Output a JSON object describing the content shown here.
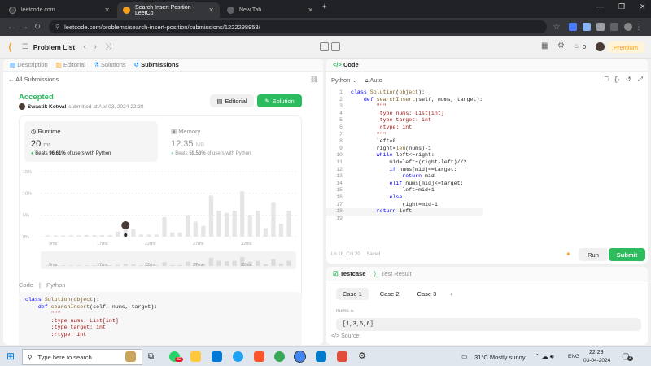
{
  "browser": {
    "tabs": [
      {
        "title": "leetcode.com",
        "active": false
      },
      {
        "title": "Search Insert Position - LeetCo",
        "active": true
      },
      {
        "title": "New Tab",
        "active": false
      }
    ],
    "url": "leetcode.com/problems/search-insert-position/submissions/1222298958/"
  },
  "header": {
    "logo": "⟨",
    "problem_list": "Problem List",
    "coins": "0",
    "premium": "Premium"
  },
  "left_tabs": [
    "Description",
    "Editorial",
    "Solutions",
    "Submissions"
  ],
  "all_submissions": "All Submissions",
  "result": {
    "status": "Accepted",
    "user": "Swastik Kotwal",
    "submitted": "submitted at Apr 03, 2024 22:28",
    "editorial_btn": "Editorial",
    "solution_btn": "Solution"
  },
  "runtime": {
    "label": "Runtime",
    "value": "20",
    "unit": "ms",
    "beats_prefix": "Beats",
    "beats_pct": "96.61%",
    "beats_suffix": "of users with Python"
  },
  "memory": {
    "label": "Memory",
    "value": "12.35",
    "unit": "MB",
    "beats_prefix": "Beats",
    "beats_pct": "59.53%",
    "beats_suffix": "of users with Python"
  },
  "chart_data": {
    "type": "bar",
    "y_ticks": [
      "15%",
      "10%",
      "5%",
      "0%"
    ],
    "x_ticks": [
      "9ms",
      "17ms",
      "22ms",
      "27ms",
      "32ms"
    ],
    "ylim": [
      0,
      15
    ],
    "values": [
      0.3,
      0.3,
      0.3,
      0.3,
      0.3,
      0.4,
      0.4,
      0.4,
      0.4,
      1.2,
      2.5,
      1.8,
      0.5,
      0.5,
      0.5,
      4.5,
      1.0,
      1.0,
      5.0,
      3.5,
      2.5,
      9.5,
      6.0,
      5.5,
      6.0,
      10.5,
      5.0,
      6.0,
      2.0,
      8.0,
      3.0,
      6.0
    ]
  },
  "code_label": "Code",
  "code_lang": "Python",
  "right": {
    "title": "Code",
    "lang": "Python",
    "auto": "Auto",
    "status": "Ln 18, Col 20",
    "saved": "Saved",
    "run": "Run",
    "submit": "Submit",
    "lines": [
      "class Solution(object):",
      "    def searchInsert(self, nums, target):",
      "        \"\"\"",
      "        :type nums: List[int]",
      "        :type target: int",
      "        :rtype: int",
      "        \"\"\"",
      "        left=0",
      "        right=len(nums)-1",
      "        while left<=right:",
      "            mid=left+(right-left)//2",
      "            if nums[mid]==target:",
      "                return mid",
      "            elif nums[mid]<=target:",
      "                left=mid+1",
      "            else:",
      "                right=mid-1",
      "        return left",
      ""
    ]
  },
  "left_code": [
    "class Solution(object):",
    "    def searchInsert(self, nums, target):",
    "        \"\"\"",
    "        :type nums: List[int]",
    "        :type target: int",
    "        :rtype: int"
  ],
  "testcase": {
    "tab1": "Testcase",
    "tab2": "Test Result",
    "cases": [
      "Case 1",
      "Case 2",
      "Case 3"
    ],
    "add": "+",
    "nums_label": "nums =",
    "nums_value": "[1,3,5,6]",
    "source": "Source"
  },
  "taskbar": {
    "search": "Type here to search",
    "weather": "31°C  Mostly sunny",
    "lang": "ENG",
    "time": "22:29",
    "date": "03-04-2024",
    "badge": "32",
    "notif": "4"
  }
}
